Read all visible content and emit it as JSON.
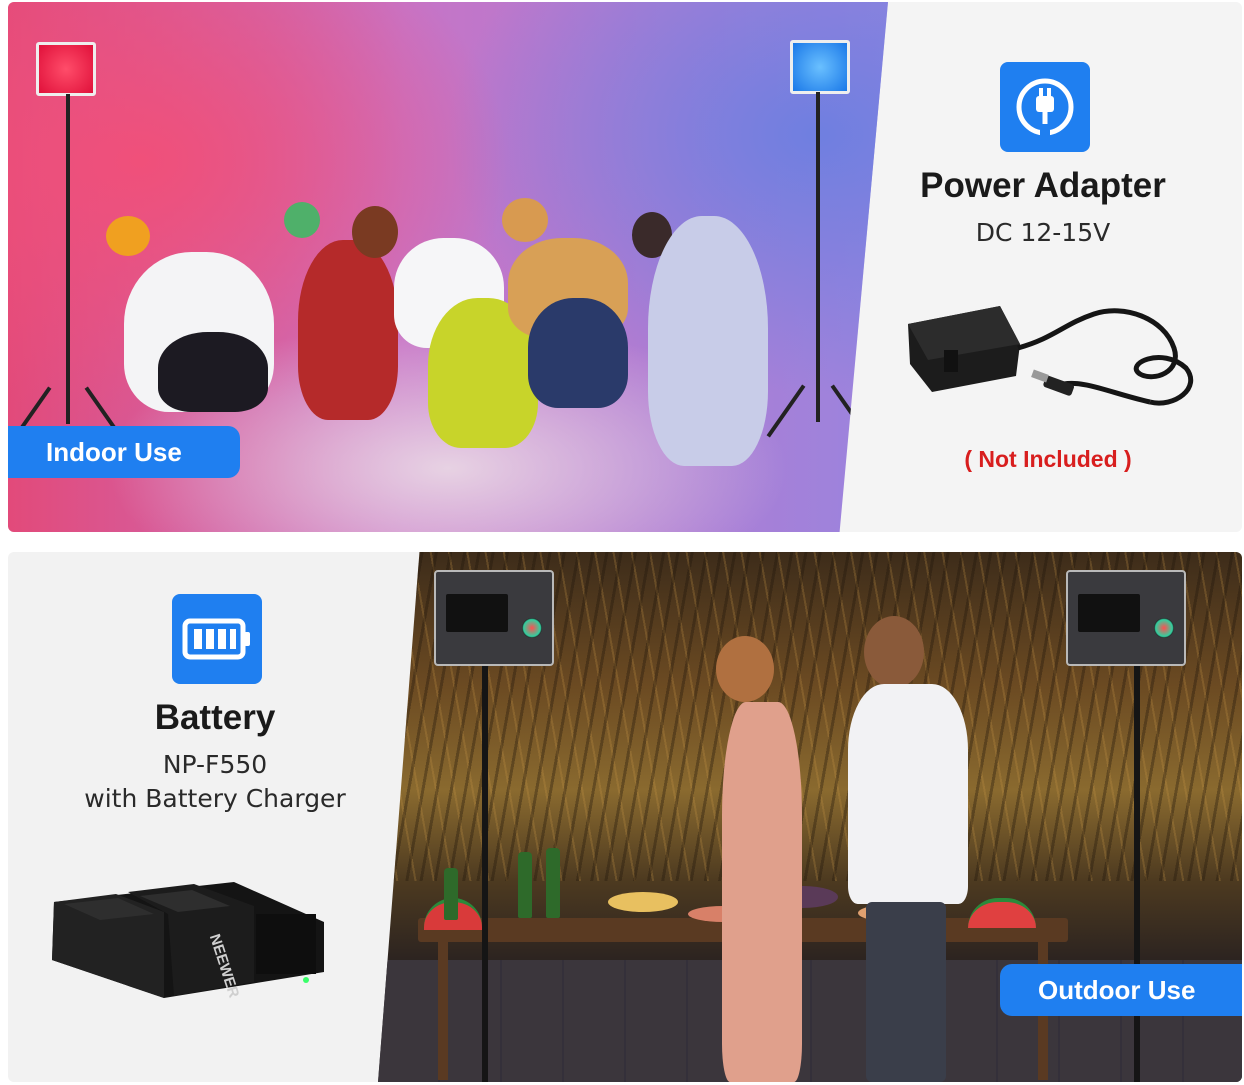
{
  "indoor": {
    "label": "Indoor Use"
  },
  "power_adapter": {
    "icon": "plug-icon",
    "title": "Power Adapter",
    "spec": "DC 12-15V",
    "note": "( Not Included )",
    "note_color": "#d81e1e"
  },
  "battery": {
    "icon": "battery-icon",
    "title": "Battery",
    "model": "NP-F550",
    "charger": "with Battery Charger",
    "brand": "NEEWER"
  },
  "outdoor": {
    "label": "Outdoor Use"
  },
  "colors": {
    "accent": "#1f7ff0"
  }
}
